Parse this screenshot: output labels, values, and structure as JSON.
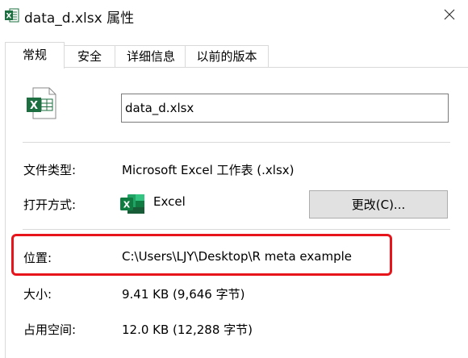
{
  "window": {
    "title": "data_d.xlsx 属性",
    "icons": {
      "title": "excel-file-icon",
      "close": "close-icon"
    }
  },
  "tabs": [
    {
      "label": "常规",
      "active": true
    },
    {
      "label": "安全",
      "active": false
    },
    {
      "label": "详细信息",
      "active": false
    },
    {
      "label": "以前的版本",
      "active": false
    }
  ],
  "general": {
    "filename": "data_d.xlsx",
    "type_label": "文件类型:",
    "type_value": "Microsoft Excel 工作表 (.xlsx)",
    "opens_with_label": "打开方式:",
    "opens_with_app": "Excel",
    "change_button": "更改(C)...",
    "location_label": "位置:",
    "location_value": "C:\\Users\\LJY\\Desktop\\R meta example",
    "size_label": "大小:",
    "size_value": "9.41 KB (9,646 字节)",
    "disk_size_label": "占用空间:",
    "disk_size_value": "12.0 KB (12,288 字节)"
  },
  "colors": {
    "excel_green": "#1D6F42",
    "highlight_red": "#E8141B",
    "button_bg": "#E1E1E1",
    "border": "#D9D9D9"
  }
}
